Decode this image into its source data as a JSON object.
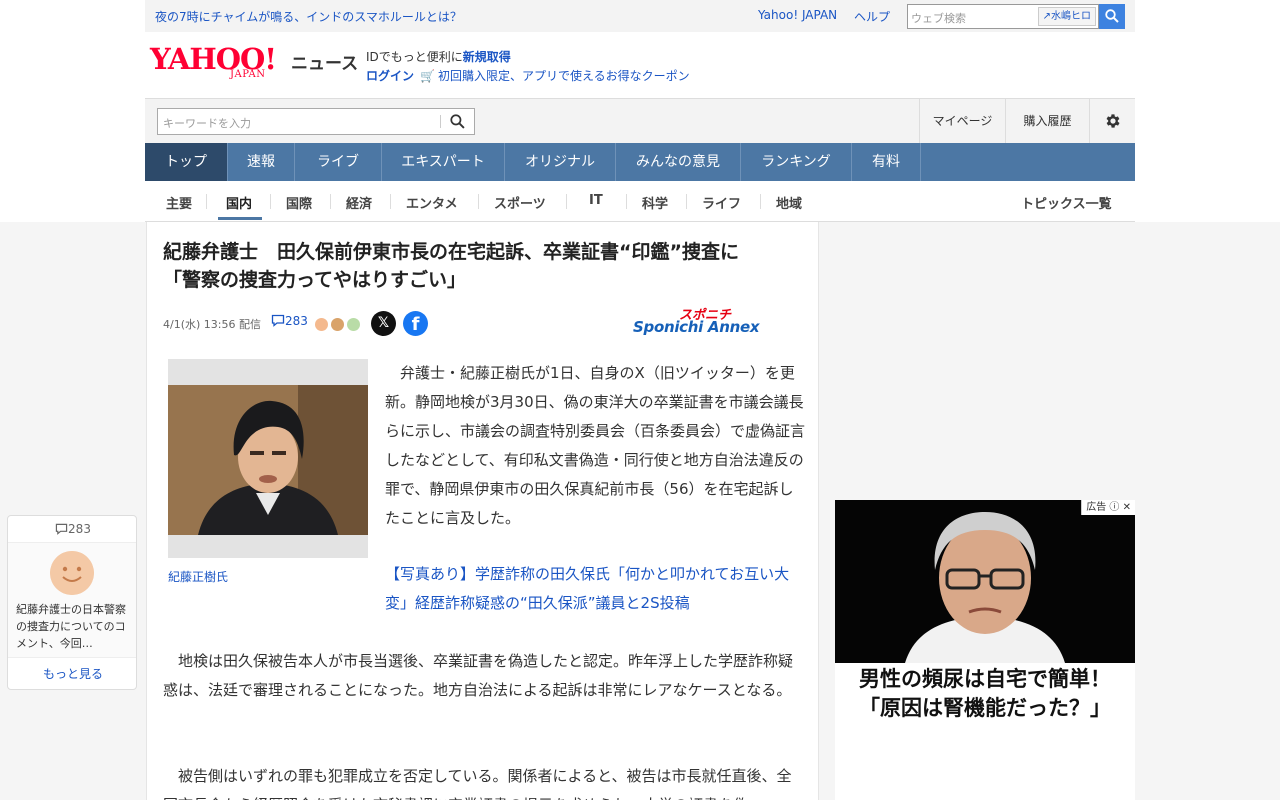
{
  "topbar": {
    "headline": "夜の7時にチャイムが鳴る、インドのスマホルールとは？",
    "yahoo_japan": "Yahoo! JAPAN",
    "help": "ヘルプ",
    "web_search_placeholder": "ウェブ検索",
    "person_chip": "水嶋ヒロ"
  },
  "brand": {
    "yahoo": "YAHOO!",
    "japan": "JAPAN",
    "news": "ニュース"
  },
  "promo": {
    "line1_prefix": "IDでもっと便利に",
    "line1_link": "新規取得",
    "login": "ログイン",
    "line2": "初回購入限定、アプリで使えるお得なクーポン"
  },
  "search_row": {
    "placeholder": "キーワードを入力",
    "mypage": "マイページ",
    "history": "購入履歴"
  },
  "nav": {
    "items": [
      "トップ",
      "速報",
      "ライブ",
      "エキスパート",
      "オリジナル",
      "みんなの意見",
      "ランキング",
      "有料"
    ]
  },
  "subnav": {
    "items": [
      "主要",
      "国内",
      "国際",
      "経済",
      "エンタメ",
      "スポーツ",
      "IT",
      "科学",
      "ライフ",
      "地域"
    ],
    "active": "国内",
    "topics": "トピックス一覧"
  },
  "article": {
    "title_line1": "紀藤弁護士　田久保前伊東市長の在宅起訴、卒業証書“印鑑”捜査に",
    "title_line2": "「警察の捜査力ってやはりすごい」",
    "datetime": "4/1(水) 13:56 配信",
    "comment_count": "283",
    "publisher_top": "スポニチ",
    "publisher_bottom": "Sponichi Annex",
    "photo_caption": "紀藤正樹氏",
    "para1": "　弁護士・紀藤正樹氏が1日、自身のX（旧ツイッター）を更新。静岡地検が3月30日、偽の東洋大の卒業証書を市議会議長らに示し、市議会の調査特別委員会（百条委員会）で虚偽証言したなどとして、有印私文書偽造・同行使と地方自治法違反の罪で、静岡県伊東市の田久保真紀前市長（56）を在宅起訴したことに言及した。",
    "related_link": "【写真あり】学歴詐称の田久保氏「何かと叩かれてお互い大変」経歴詐称疑惑の“田久保派”議員と2S投稿",
    "para2": "　地検は田久保被告本人が市長当選後、卒業証書を偽造したと認定。昨年浮上した学歴詐称疑惑は、法廷で審理されることになった。地方自治法による起訴は非常にレアなケースとなる。",
    "para3": "　被告側はいずれの罪も犯罪成立を否定している。関係者によると、被告は市長就任直後、全国市長会から経歴照会を受けた市秘書課に卒業証書の提示を求められ、大学の証書を偽"
  },
  "comment_widget": {
    "count": "283",
    "text": "紀藤弁護士の日本警察の捜査力についてのコメント、今回…",
    "more": "もっと見る"
  },
  "ad": {
    "badge": "広告",
    "line1": "男性の頻尿は自宅で簡単！",
    "line2": "「原因は腎機能だった？」"
  },
  "colors": {
    "brand_red": "#ff0033",
    "nav_blue": "#4c77a4",
    "nav_active": "#2d4a6a",
    "link_blue": "#1a55c4"
  }
}
